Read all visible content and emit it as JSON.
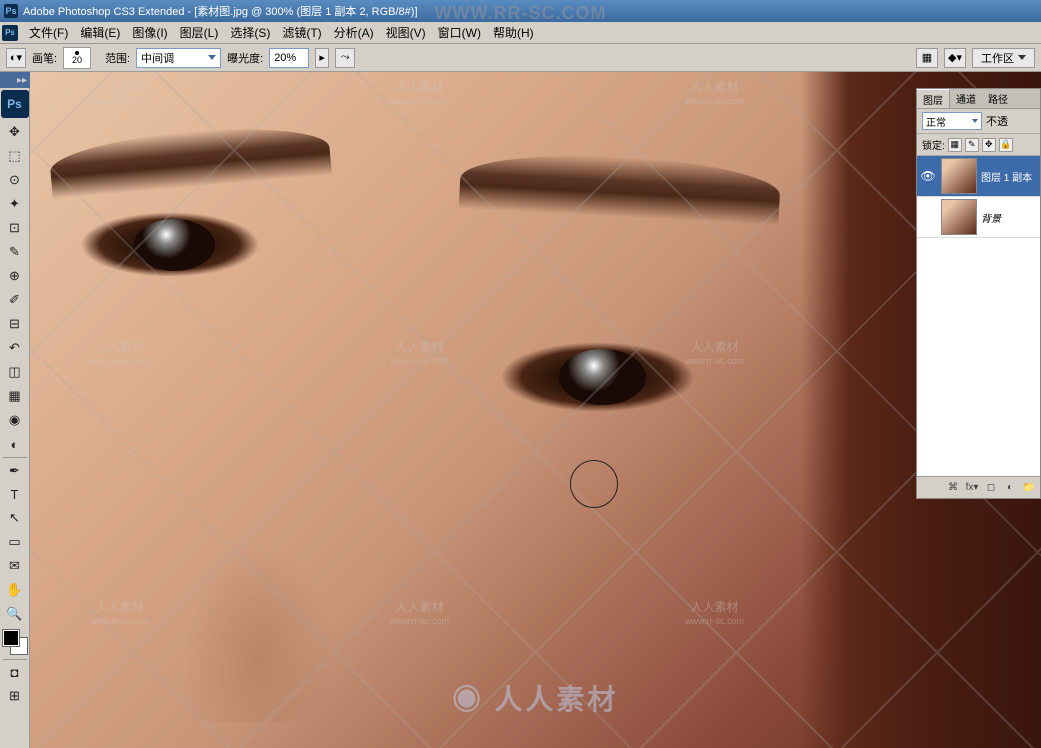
{
  "title": "Adobe Photoshop CS3 Extended - [素材图.jpg @ 300% (图层 1 副本 2, RGB/8#)]",
  "top_watermark": "WWW.RR-SC.COM",
  "menu": {
    "file": "文件(F)",
    "edit": "编辑(E)",
    "image": "图像(I)",
    "layer": "图层(L)",
    "select": "选择(S)",
    "filter": "滤镜(T)",
    "analysis": "分析(A)",
    "view": "视图(V)",
    "window": "窗口(W)",
    "help": "帮助(H)"
  },
  "options": {
    "brush_label": "画笔:",
    "brush_size": "20",
    "range_label": "范围:",
    "range_value": "中间调",
    "exposure_label": "曝光度:",
    "exposure_value": "20%",
    "workspace": "工作区"
  },
  "tools": {
    "move": "✥",
    "marquee": "⬚",
    "lasso": "⊙",
    "wand": "✦",
    "crop": "⊡",
    "eyedropper": "✎",
    "healing": "⊕",
    "brush": "✐",
    "stamp": "⊟",
    "history": "↶",
    "eraser": "◫",
    "gradient": "▦",
    "blur": "◉",
    "dodge": "◐",
    "pen": "✒",
    "type": "T",
    "path": "↖",
    "shape": "▭",
    "notes": "✉",
    "hand": "✋",
    "zoom": "🔍",
    "quickmask": "◘",
    "screenmode": "⊞"
  },
  "layers_panel": {
    "tab1": "图层",
    "tab2": "通道",
    "tab3": "路径",
    "blend_mode": "正常",
    "opacity_label": "不透",
    "lock_label": "锁定:",
    "layer1_name": "图层 1 副本",
    "layer2_name": "背景"
  },
  "watermark": {
    "text": "人人素材",
    "url": "www.rr-sc.com",
    "logo": "人人素材"
  }
}
